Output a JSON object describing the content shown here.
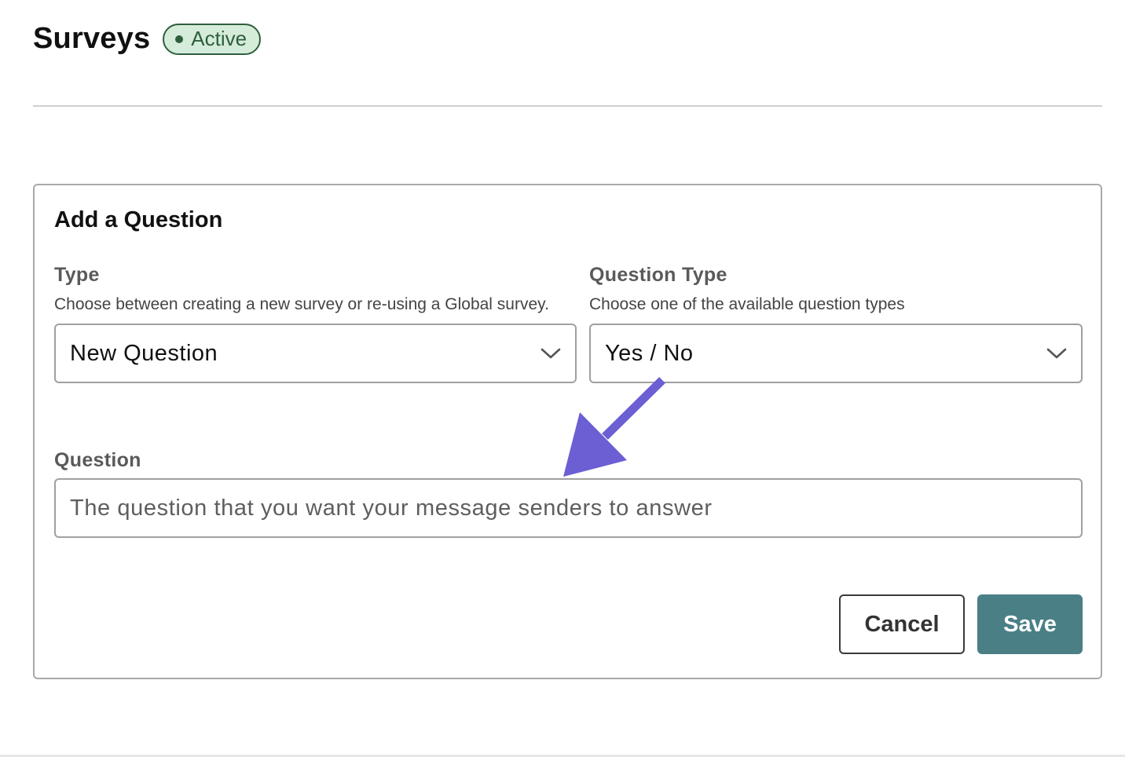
{
  "header": {
    "title": "Surveys",
    "status": "Active"
  },
  "card": {
    "title": "Add a Question",
    "type_field": {
      "label": "Type",
      "help": "Choose between creating a new survey or re-using a Global survey.",
      "value": "New Question"
    },
    "question_type_field": {
      "label": "Question Type",
      "help": "Choose one of the available question types",
      "value": "Yes / No"
    },
    "question_field": {
      "label": "Question",
      "value": "",
      "placeholder": "The question that you want your message senders to answer"
    },
    "actions": {
      "cancel_label": "Cancel",
      "save_label": "Save"
    }
  },
  "colors": {
    "status_badge_bg": "#d5ecdb",
    "status_badge_fg": "#2f5e3d",
    "save_button_bg": "#4a7f86",
    "annotation_arrow": "#6b5fd3"
  },
  "icons": {
    "status": "dot-icon",
    "select_toggle": "chevron-down-icon",
    "annotation": "arrow-icon"
  }
}
